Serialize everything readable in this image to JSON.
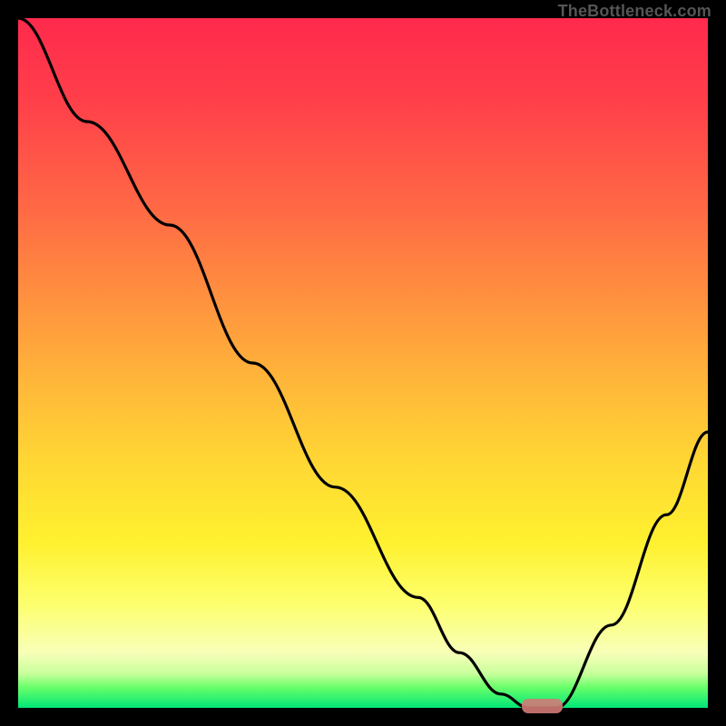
{
  "attribution": "TheBottleneck.com",
  "colors": {
    "frame": "#000000",
    "gradient_top": "#ff2a4d",
    "gradient_mid": "#ffd634",
    "gradient_bottom": "#00e676",
    "curve": "#000000",
    "marker": "#d27a77"
  },
  "chart_data": {
    "type": "line",
    "title": "",
    "xlabel": "",
    "ylabel": "",
    "xlim": [
      0,
      100
    ],
    "ylim": [
      0,
      100
    ],
    "grid": false,
    "legend_position": "none",
    "annotations": [
      "TheBottleneck.com"
    ],
    "series": [
      {
        "name": "bottleneck-curve",
        "x": [
          0,
          10,
          22,
          34,
          46,
          58,
          64,
          70,
          74,
          78,
          86,
          94,
          100
        ],
        "y": [
          100,
          85,
          70,
          50,
          32,
          16,
          8,
          2,
          0,
          0,
          12,
          28,
          40
        ]
      }
    ],
    "optimal_marker": {
      "x": 76,
      "y": 0,
      "width": 6,
      "height": 2
    }
  }
}
